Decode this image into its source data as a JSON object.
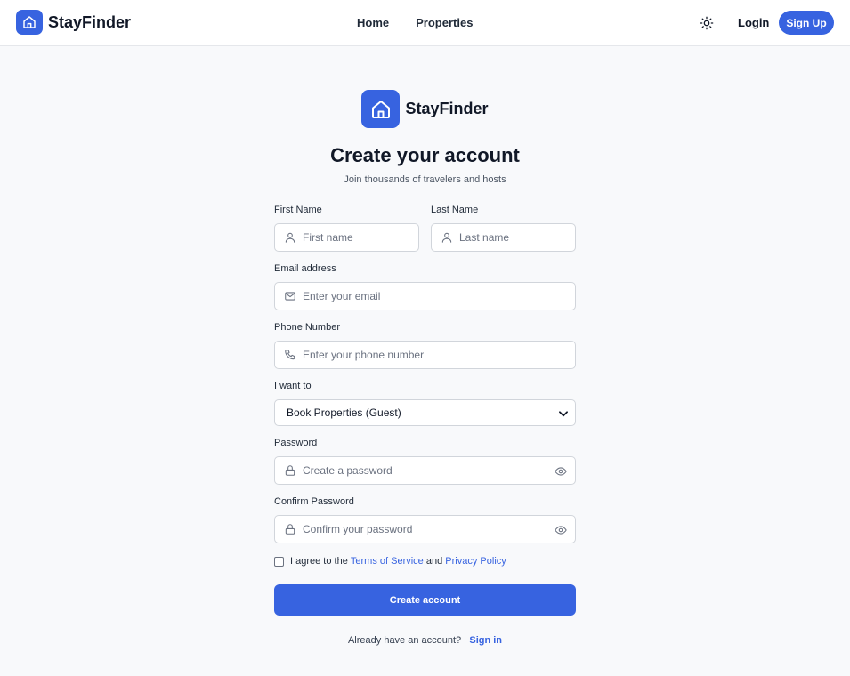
{
  "header": {
    "brand": "StayFinder",
    "nav": [
      "Home",
      "Properties"
    ],
    "login": "Login",
    "signup": "Sign Up",
    "theme_icon": "sun-icon"
  },
  "hero": {
    "brand": "StayFinder",
    "title": "Create your account",
    "subtitle": "Join thousands of travelers and hosts"
  },
  "form": {
    "first_name": {
      "label": "First Name",
      "placeholder": "First name",
      "value": "",
      "icon": "user-icon"
    },
    "last_name": {
      "label": "Last Name",
      "placeholder": "Last name",
      "value": "",
      "icon": "user-icon"
    },
    "email": {
      "label": "Email address",
      "placeholder": "Enter your email",
      "value": "",
      "icon": "mail-icon"
    },
    "phone": {
      "label": "Phone Number",
      "placeholder": "Enter your phone number",
      "value": "",
      "icon": "phone-icon"
    },
    "role": {
      "label": "I want to",
      "selected": "Book Properties (Guest)"
    },
    "password": {
      "label": "Password",
      "placeholder": "Create a password",
      "value": "",
      "icon": "lock-icon"
    },
    "confirm_password": {
      "label": "Confirm Password",
      "placeholder": "Confirm your password",
      "value": "",
      "icon": "lock-icon"
    },
    "agree": {
      "prefix": "I agree to the",
      "terms": "Terms of Service",
      "and": "and",
      "privacy": "Privacy Policy",
      "checked": false
    },
    "submit": "Create account",
    "signin_prompt": "Already have an account?",
    "signin_link": "Sign in"
  },
  "colors": {
    "accent": "#3763e0",
    "background": "#f8f9fb",
    "border": "#d1d5db"
  }
}
